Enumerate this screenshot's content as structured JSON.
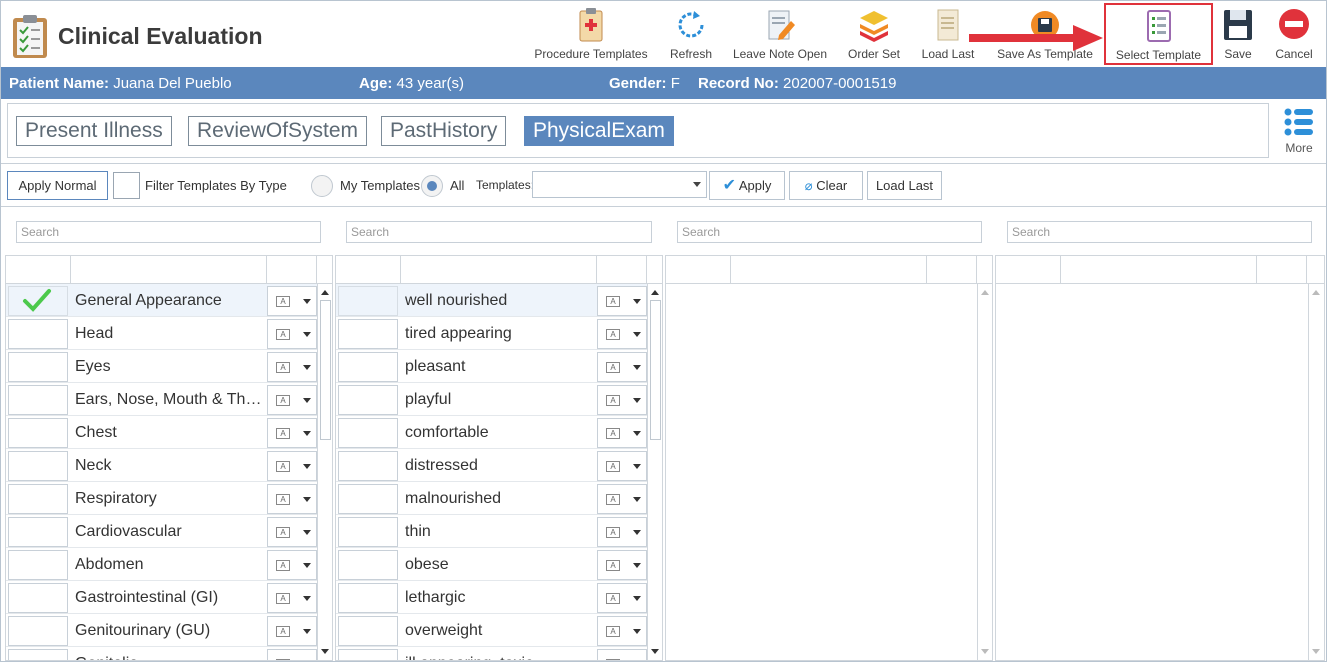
{
  "app": {
    "title": "Clinical Evaluation"
  },
  "toolbar": [
    {
      "label": "Procedure Templates",
      "icon": "clipboard-cross-icon"
    },
    {
      "label": "Refresh",
      "icon": "refresh-icon"
    },
    {
      "label": "Leave Note Open",
      "icon": "note-pencil-icon"
    },
    {
      "label": "Order Set",
      "icon": "layers-icon"
    },
    {
      "label": "Load Last",
      "icon": "document-icon"
    },
    {
      "label": "Save As Template",
      "icon": "save-as-template-icon"
    },
    {
      "label": "Select Template",
      "icon": "template-list-icon"
    },
    {
      "label": "Save",
      "icon": "floppy-disk-icon"
    },
    {
      "label": "Cancel",
      "icon": "cancel-icon"
    }
  ],
  "patient": {
    "name_label": "Patient Name:",
    "name": "Juana Del Pueblo",
    "age_label": "Age:",
    "age": "43 year(s)",
    "gender_label": "Gender:",
    "gender": "F",
    "record_label": "Record No:",
    "record": "202007-0001519"
  },
  "tabs": [
    {
      "label": "Present Illness",
      "active": false
    },
    {
      "label": "ReviewOfSystem",
      "active": false
    },
    {
      "label": "PastHistory",
      "active": false
    },
    {
      "label": "PhysicalExam",
      "active": true
    }
  ],
  "more_label": "More",
  "filter": {
    "apply_normal": "Apply Normal",
    "filter_by_type": "Filter Templates By Type",
    "my_templates": "My Templates",
    "all": "All",
    "templates_label": "Templates:",
    "apply": "Apply",
    "clear": "Clear",
    "load_last": "Load Last"
  },
  "search_placeholder": "Search",
  "systems": [
    "General Appearance",
    "Head",
    "Eyes",
    "Ears, Nose, Mouth & Thr...",
    "Chest",
    "Neck",
    "Respiratory",
    "Cardiovascular",
    "Abdomen",
    "Gastrointestinal (GI)",
    "Genitourinary (GU)",
    "Genitalia"
  ],
  "findings": [
    "well nourished",
    "tired appearing",
    "pleasant",
    "playful",
    "comfortable",
    "distressed",
    "malnourished",
    "thin",
    "obese",
    "lethargic",
    "overweight",
    "ill appearing, toxic"
  ],
  "colors": {
    "accent": "#5b87bd",
    "highlight": "#e0323b",
    "check": "#4cc94c"
  }
}
